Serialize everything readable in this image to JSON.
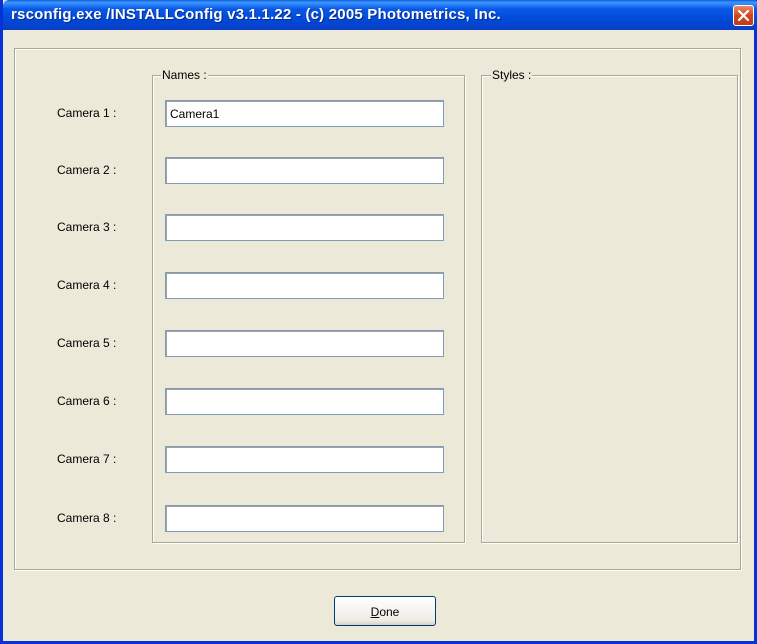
{
  "window": {
    "title": "rsconfig.exe /INSTALLConfig v3.1.1.22 - (c) 2005 Photometrics, Inc."
  },
  "names_group": {
    "label": "Names :"
  },
  "styles_group": {
    "label": "Styles :"
  },
  "cameras": [
    {
      "label": "Camera 1 :",
      "value": "Camera1"
    },
    {
      "label": "Camera 2 :",
      "value": ""
    },
    {
      "label": "Camera 3 :",
      "value": ""
    },
    {
      "label": "Camera 4 :",
      "value": ""
    },
    {
      "label": "Camera 5 :",
      "value": ""
    },
    {
      "label": "Camera 6 :",
      "value": ""
    },
    {
      "label": "Camera 7 :",
      "value": ""
    },
    {
      "label": "Camera 8 :",
      "value": ""
    }
  ],
  "done_button": {
    "mnemonic": "D",
    "rest": "one"
  }
}
